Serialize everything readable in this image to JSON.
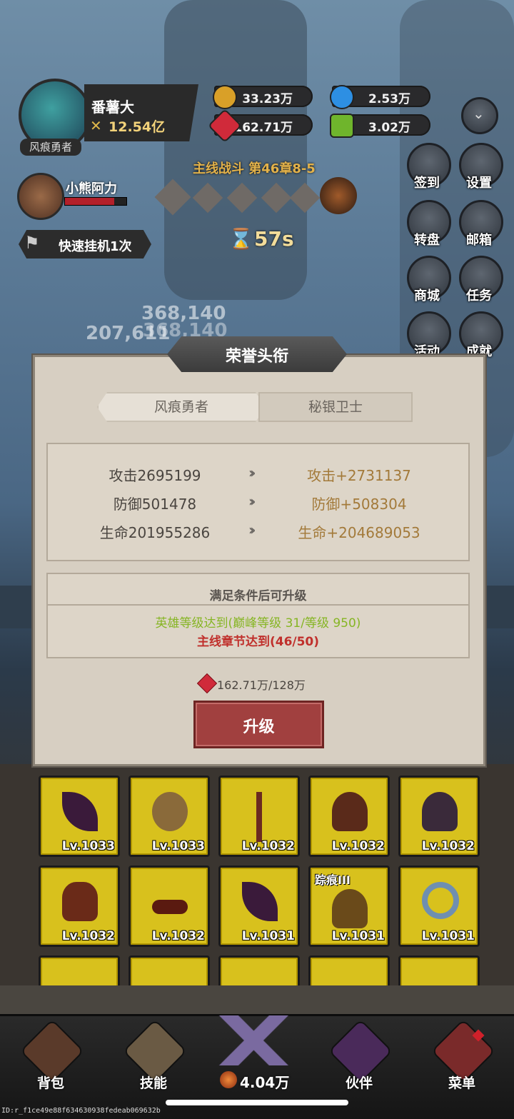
{
  "player": {
    "name": "番薯大",
    "power": "12.54亿",
    "title": "风痕勇者"
  },
  "companion": {
    "name": "小熊阿力"
  },
  "quick_idle": {
    "label": "快速挂机1次"
  },
  "resources": {
    "gold": "33.23万",
    "blue_crystal": "2.53万",
    "ruby": "162.71万",
    "cash": "3.02万"
  },
  "stage": {
    "title": "主线战斗 第46章8-5",
    "timer": "57s"
  },
  "damage_numbers": [
    "368,140",
    "207,611",
    "368,140"
  ],
  "side_menu": [
    {
      "label": "签到",
      "icon": "calendar-icon"
    },
    {
      "label": "设置",
      "icon": "gear-icon"
    },
    {
      "label": "转盘",
      "icon": "wheel-icon"
    },
    {
      "label": "邮箱",
      "icon": "mail-icon"
    },
    {
      "label": "商城",
      "icon": "shop-icon"
    },
    {
      "label": "任务",
      "icon": "scroll-icon"
    },
    {
      "label": "活动",
      "icon": "tap-icon"
    },
    {
      "label": "成就",
      "icon": "laurel-icon"
    }
  ],
  "modal": {
    "title": "荣誉头衔",
    "tabs": [
      {
        "label": "风痕勇者"
      },
      {
        "label": "秘银卫士"
      }
    ],
    "stats": [
      {
        "current": "攻击2695199",
        "next": "攻击+2731137"
      },
      {
        "current": "防御501478",
        "next": "防御+508304"
      },
      {
        "current": "生命201955286",
        "next": "生命+204689053"
      }
    ],
    "conditions_title": "满足条件后可升级",
    "condition_1": "英雄等级达到(巅峰等级 31/等级 950)",
    "condition_2": "主线章节达到(46/50)",
    "cost": "162.71万/128万",
    "upgrade_label": "升级"
  },
  "items": [
    {
      "label": "Lv.1033",
      "tag": ""
    },
    {
      "label": "Lv.1033",
      "tag": ""
    },
    {
      "label": "Lv.1032",
      "tag": ""
    },
    {
      "label": "Lv.1032",
      "tag": ""
    },
    {
      "label": "Lv.1032",
      "tag": ""
    },
    {
      "label": "Lv.1032",
      "tag": ""
    },
    {
      "label": "Lv.1032",
      "tag": ""
    },
    {
      "label": "Lv.1031",
      "tag": ""
    },
    {
      "label": "Lv.1031",
      "tag": "踪痕III"
    },
    {
      "label": "Lv.1031",
      "tag": ""
    }
  ],
  "tabbar": {
    "bag": "背包",
    "skill": "技能",
    "center_value": "4.04万",
    "partner": "伙伴",
    "menu": "菜单"
  },
  "footer_id": "ID:r_f1ce49e88f634630938fedeab069632b",
  "colors": {
    "accent_red": "#a1403f",
    "gold_text": "#a37a3a",
    "condition_green": "#86b524",
    "condition_red": "#c0302c"
  }
}
